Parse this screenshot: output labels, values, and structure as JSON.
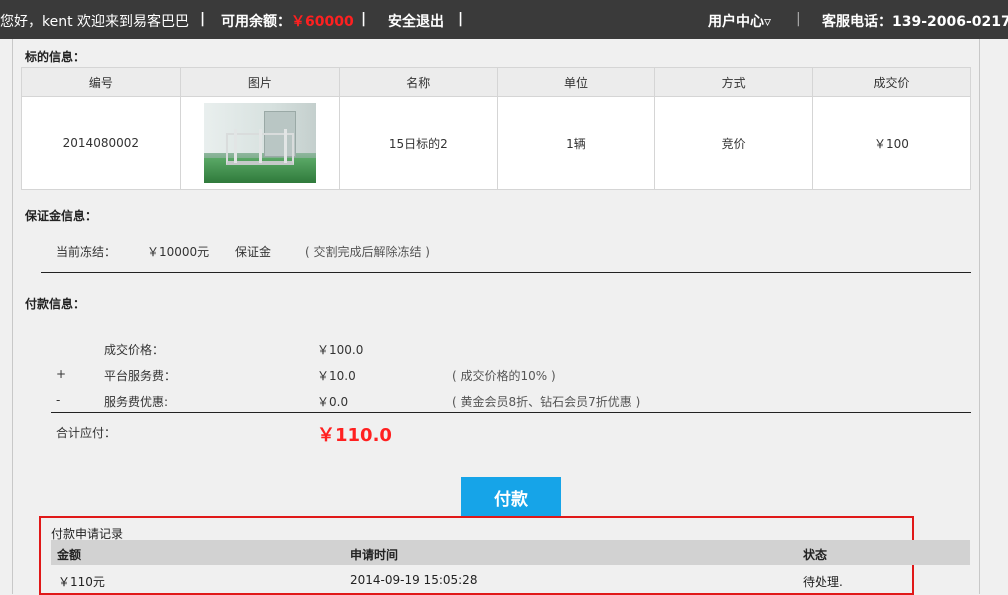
{
  "topbar": {
    "greeting": "您好，kent 欢迎来到易客巴巴",
    "sep1": "|",
    "balance_label": "可用余额：",
    "balance_value": "￥60000",
    "sep2": "|",
    "logout": "安全退出",
    "sep3": "|",
    "user_center": "用户中心▿",
    "sep4": "|",
    "service_phone": "客服电话：139-2006-0217"
  },
  "item_section": {
    "title": "标的信息：",
    "columns": [
      "编号",
      "图片",
      "名称",
      "单位",
      "方式",
      "成交价"
    ],
    "row": {
      "number": "2014080002",
      "name": "15日标的2",
      "unit": "1辆",
      "method": "竞价",
      "price": "￥100"
    }
  },
  "deposit_section": {
    "title": "保证金信息：",
    "frozen_label": "当前冻结：",
    "frozen_amount": "￥10000元",
    "type": "保证金",
    "note": "( 交割完成后解除冻结 )"
  },
  "payment_section": {
    "title": "付款信息：",
    "deal_price_label": "成交价格：",
    "deal_price_value": "￥100.0",
    "plus_sign": "+",
    "service_fee_label": "平台服务费：",
    "service_fee_value": "￥10.0",
    "service_fee_note": "( 成交价格的10% )",
    "minus_sign": "-",
    "discount_label": "服务费优惠:",
    "discount_value": "￥0.0",
    "discount_note": "( 黄金会员8折、钻石会员7折优惠 )",
    "total_label": "合计应付：",
    "total_value": "￥110.0"
  },
  "pay_button": "付款",
  "records": {
    "title": "付款申请记录",
    "columns": [
      "金额",
      "申请时间",
      "状态"
    ],
    "rows": [
      {
        "amount": "￥110元",
        "time": "2014-09-19 15:05:28",
        "status": "待处理."
      }
    ]
  },
  "colors": {
    "topbar_bg": "#3a3a3a",
    "accent_red": "#ff2020",
    "button_blue": "#16a4e8",
    "record_border": "#e01818"
  }
}
